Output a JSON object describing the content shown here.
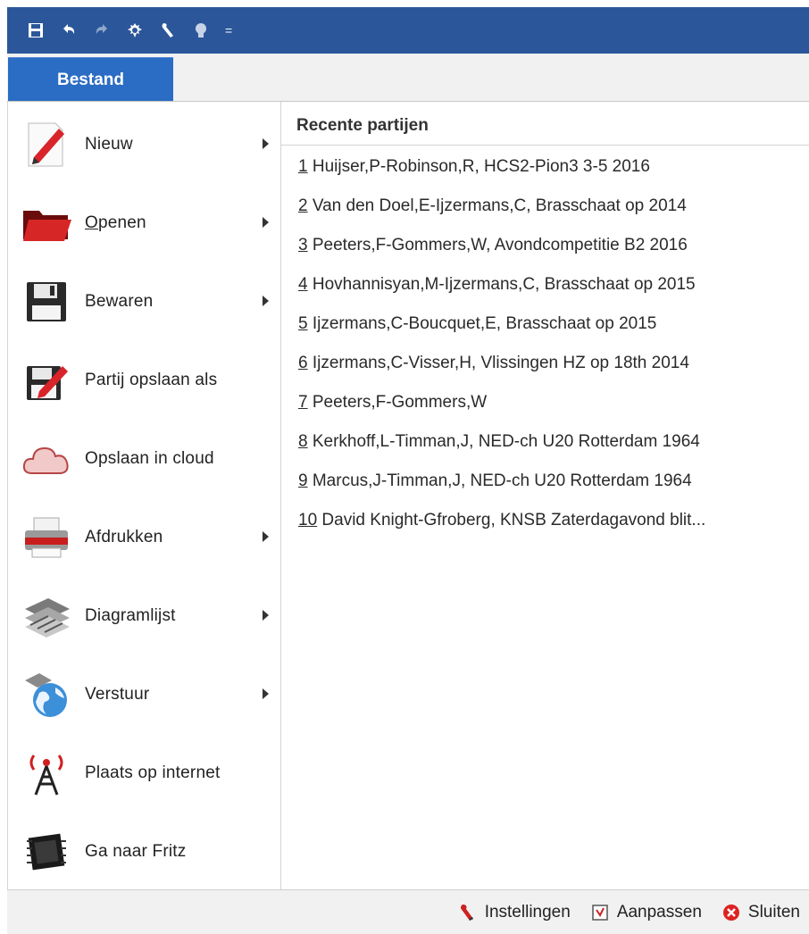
{
  "quick_access": {
    "buttons": [
      "save-icon",
      "undo-icon",
      "redo-icon",
      "engine-icon",
      "wrench-icon",
      "bulb-icon"
    ],
    "more_glyph": "="
  },
  "ribbon": {
    "file_tab": "Bestand"
  },
  "menu": {
    "items": [
      {
        "label_pre": "",
        "label_ul": "",
        "label_post": "Nieuw",
        "icon": "pencil-icon"
      },
      {
        "label_pre": "",
        "label_ul": "O",
        "label_post": "penen",
        "icon": "folder-icon"
      },
      {
        "label_pre": "",
        "label_ul": "",
        "label_post": "Bewaren",
        "icon": "floppy-icon"
      },
      {
        "label_pre": "",
        "label_ul": "",
        "label_post": "Partij opslaan als",
        "icon": "save-as-icon"
      },
      {
        "label_pre": "",
        "label_ul": "",
        "label_post": "Opslaan in cloud",
        "icon": "cloud-icon"
      },
      {
        "label_pre": "",
        "label_ul": "",
        "label_post": "Afdrukken",
        "icon": "printer-icon"
      },
      {
        "label_pre": "",
        "label_ul": "",
        "label_post": "Diagramlijst",
        "icon": "chessboard-icon"
      },
      {
        "label_pre": "",
        "label_ul": "",
        "label_post": "Verstuur",
        "icon": "globe-icon"
      },
      {
        "label_pre": "",
        "label_ul": "",
        "label_post": "Plaats op internet",
        "icon": "antenna-icon"
      },
      {
        "label_pre": "",
        "label_ul": "",
        "label_post": "Ga naar Fritz",
        "icon": "chip-icon"
      }
    ]
  },
  "recent": {
    "title": "Recente partijen",
    "items": [
      {
        "num": "1",
        "text": " Huijser,P-Robinson,R, HCS2-Pion3 3-5 2016"
      },
      {
        "num": "2",
        "text": " Van den Doel,E-Ijzermans,C, Brasschaat op 2014"
      },
      {
        "num": "3",
        "text": " Peeters,F-Gommers,W, Avondcompetitie B2 2016"
      },
      {
        "num": "4",
        "text": " Hovhannisyan,M-Ijzermans,C, Brasschaat op 2015"
      },
      {
        "num": "5",
        "text": " Ijzermans,C-Boucquet,E, Brasschaat op 2015"
      },
      {
        "num": "6",
        "text": " Ijzermans,C-Visser,H, Vlissingen HZ op 18th 2014"
      },
      {
        "num": "7",
        "text": " Peeters,F-Gommers,W"
      },
      {
        "num": "8",
        "text": " Kerkhoff,L-Timman,J, NED-ch U20 Rotterdam 1964"
      },
      {
        "num": "9",
        "text": " Marcus,J-Timman,J, NED-ch U20 Rotterdam 1964"
      },
      {
        "num": "10",
        "text": " David Knight-Gfroberg, KNSB Zaterdagavond blit..."
      }
    ]
  },
  "footer": {
    "settings": "Instellingen",
    "customize": "Aanpassen",
    "close": "Sluiten"
  }
}
